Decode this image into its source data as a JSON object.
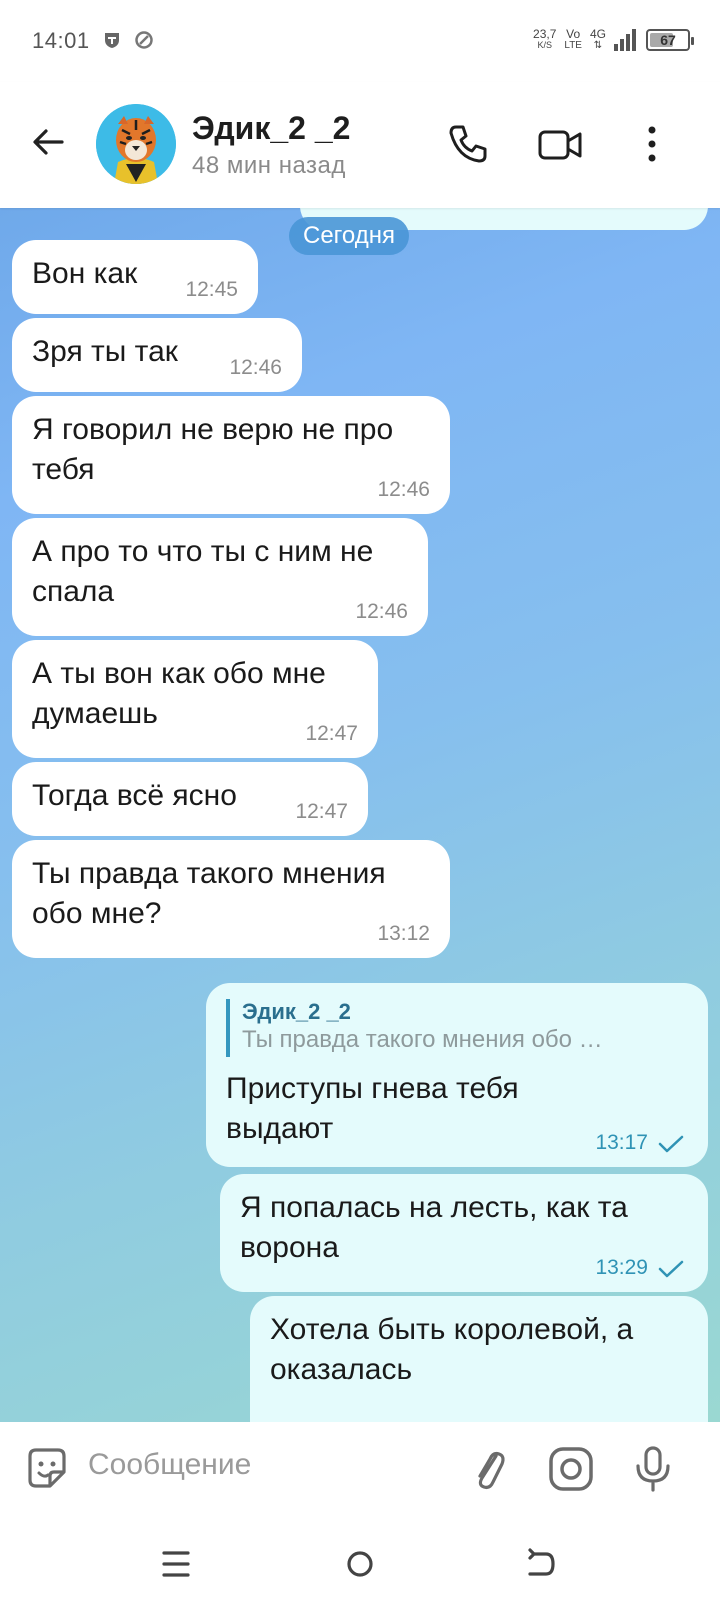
{
  "status_bar": {
    "time": "14:01",
    "net_speed_value": "23,7",
    "net_speed_unit": "K/S",
    "volte_top": "Vo",
    "volte_bottom": "LTE",
    "network": "4G",
    "battery_percent": "67",
    "battery_level": 0.67
  },
  "header": {
    "contact_name": "Эдик_2 _2",
    "last_seen": "48 мин назад",
    "icons": [
      "back-arrow-icon",
      "phone-icon",
      "video-icon",
      "more-vert-icon"
    ]
  },
  "chat": {
    "date_separator": "Сегодня",
    "messages": [
      {
        "direction": "in",
        "lines": [
          "Вон как"
        ],
        "time": "12:45"
      },
      {
        "direction": "in",
        "lines": [
          "Зря ты так"
        ],
        "time": "12:46"
      },
      {
        "direction": "in",
        "lines": [
          "Я говорил не верю не про",
          "тебя"
        ],
        "time": "12:46"
      },
      {
        "direction": "in",
        "lines": [
          "А про то что ты с ним не",
          "спала"
        ],
        "time": "12:46"
      },
      {
        "direction": "in",
        "lines": [
          "А ты вон как обо мне",
          "думаешь"
        ],
        "time": "12:47"
      },
      {
        "direction": "in",
        "lines": [
          "Тогда всё ясно"
        ],
        "time": "12:47"
      },
      {
        "direction": "in",
        "lines": [
          "Ты правда такого мнения",
          "обо мне?"
        ],
        "time": "13:12"
      },
      {
        "direction": "out",
        "reply_to_name": "Эдик_2 _2",
        "reply_to_text": "Ты правда такого мнения обо …",
        "lines": [
          "Приступы гнева тебя",
          "выдают"
        ],
        "time": "13:17",
        "status": "sent"
      },
      {
        "direction": "out",
        "lines": [
          "Я попалась на лесть, как та",
          "ворона"
        ],
        "time": "13:29",
        "status": "sent"
      },
      {
        "direction": "out",
        "lines": [
          "Хотела быть королевой, а",
          "оказалась"
        ],
        "time": "",
        "status": ""
      }
    ]
  },
  "input": {
    "placeholder": "Сообщение",
    "icons": [
      "sticker-icon",
      "attach-icon",
      "camera-icon",
      "mic-icon"
    ]
  },
  "nav": {
    "icons": [
      "menu-icon",
      "home-icon",
      "back-icon"
    ]
  },
  "colors": {
    "accent": "#3497bf",
    "incoming_bubble": "#ffffff",
    "outgoing_bubble": "#e4fbfc",
    "date_pill": "#4996d6"
  }
}
